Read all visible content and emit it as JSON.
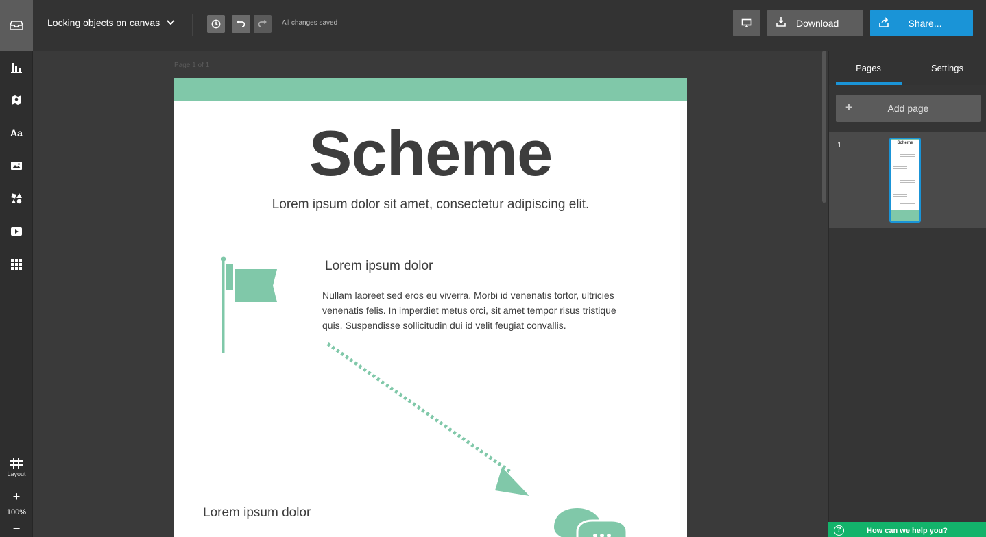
{
  "header": {
    "doc_title": "Locking objects on canvas",
    "saved_status": "All changes saved",
    "download_label": "Download",
    "share_label": "Share..."
  },
  "sidebar": {
    "tools": [
      {
        "name": "charts",
        "icon": "bar-chart-icon"
      },
      {
        "name": "maps",
        "icon": "map-pin-icon"
      },
      {
        "name": "text",
        "icon": "text-icon",
        "glyph": "Aa"
      },
      {
        "name": "photos",
        "icon": "image-icon"
      },
      {
        "name": "icons",
        "icon": "shapes-icon"
      },
      {
        "name": "videos",
        "icon": "video-icon"
      },
      {
        "name": "widgets",
        "icon": "grid-icon"
      }
    ],
    "layout_label": "Layout",
    "zoom_in": "+",
    "zoom_level": "100%",
    "zoom_out": "−"
  },
  "canvas": {
    "page_label": "Page 1 of 1",
    "title": "Scheme",
    "subtitle": "Lorem ipsum dolor sit amet, consectetur adipiscing elit.",
    "section1_heading": "Lorem ipsum dolor",
    "section1_body": "Nullam laoreet sed eros eu viverra. Morbi id venenatis tortor, ultricies venenatis felis. In imperdiet metus orci, sit amet tempor risus tristique quis. Suspendisse sollicitudin dui id velit feugiat convallis.",
    "section2_heading": "Lorem ipsum dolor",
    "accent_color": "#80c8a9"
  },
  "panel": {
    "tab_pages": "Pages",
    "tab_settings": "Settings",
    "add_page": "Add page",
    "add_page_icon": "+",
    "thumb_number": "1",
    "thumb_title": "Scheme"
  },
  "help": {
    "label": "How can we help you?",
    "icon": "?"
  },
  "colors": {
    "primary": "#1a94d7",
    "help": "#13b36b",
    "accent": "#80c8a9"
  }
}
